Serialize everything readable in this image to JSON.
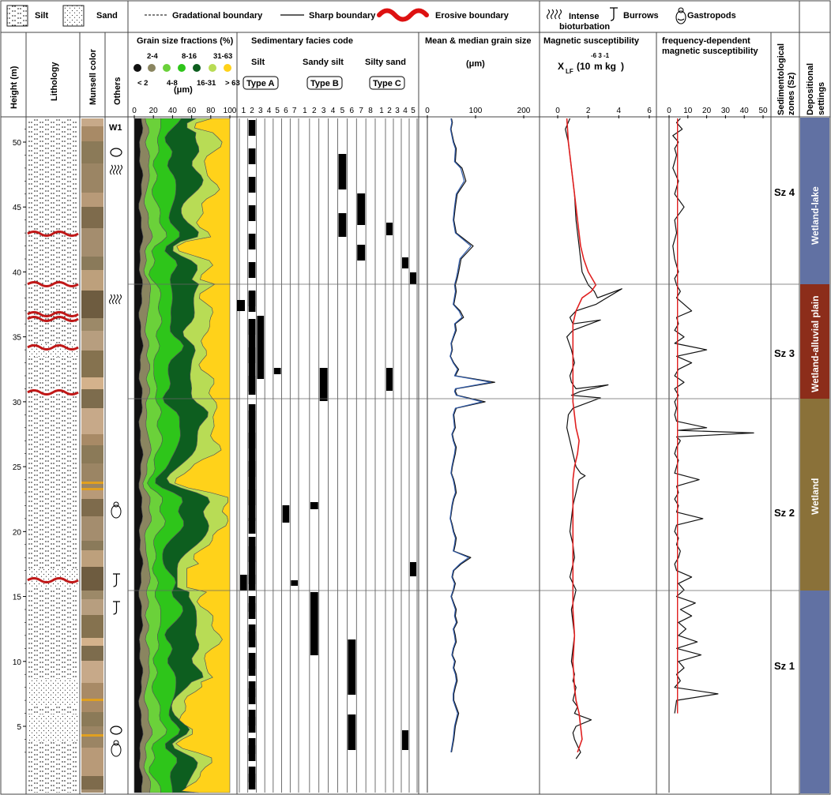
{
  "legend": {
    "silt": "Silt",
    "sand": "Sand",
    "gradational": "Gradational boundary",
    "sharp": "Sharp boundary",
    "erosive": "Erosive boundary",
    "bioturbation_line1": "Intense",
    "bioturbation_line2": "bioturbation",
    "burrows": "Burrows",
    "gastropods": "Gastropods"
  },
  "columns": {
    "height": "Height (m)",
    "lithology": "Lithology",
    "munsell": "Munsell color",
    "others": "Others",
    "grain_fractions": "Grain size fractions (%)",
    "facies": "Sedimentary facies code",
    "mean_median": "Mean & median grain size",
    "mag_sus": "Magnetic susceptibility",
    "fd_line1": "frequency-dependent",
    "fd_line2": "magnetic susceptibility",
    "sz_line1": "Sedimentological",
    "sz_line2": "zones (Sz)",
    "dep_line1": "Depositional",
    "dep_line2": "settings"
  },
  "grain_fraction_legend": {
    "classes": [
      {
        "label": "< 2",
        "color": "#111111"
      },
      {
        "label": "2-4",
        "color": "#8a8560"
      },
      {
        "label": "4-8",
        "color": "#6bd13a"
      },
      {
        "label": "8-16",
        "color": "#2ec51a"
      },
      {
        "label": "16-31",
        "color": "#0d5e1f"
      },
      {
        "label": "31-63",
        "color": "#b8dc55"
      },
      {
        "label": "> 63",
        "color": "#ffd21a"
      }
    ],
    "unit": "(μm)"
  },
  "facies_groups": [
    {
      "name": "Silt",
      "type": "Type A",
      "codes": [
        "1",
        "2",
        "3",
        "4",
        "5",
        "6",
        "7"
      ]
    },
    {
      "name": "Sandy silt",
      "type": "Type B",
      "codes": [
        "1",
        "2",
        "3",
        "4",
        "5",
        "6",
        "7",
        "8"
      ]
    },
    {
      "name": "Silty sand",
      "type": "Type C",
      "codes": [
        "1",
        "2",
        "3",
        "4",
        "5"
      ]
    }
  ],
  "others_label_w1": "W1",
  "mean_unit": "(μm)",
  "ms_unit": {
    "x": "X",
    "sub": "LF",
    "paren": "(10",
    "exp": "-6  3  -1",
    "m": "m kg",
    "close": ")"
  },
  "zones": [
    "Sz 4",
    "Sz 3",
    "Sz 2",
    "Sz 1"
  ],
  "settings": [
    {
      "label": "Wetland-lake",
      "color": "#6171a3"
    },
    {
      "label": "Wetland-alluvial plain",
      "color": "#8c2d1a"
    },
    {
      "label": "Wetland",
      "color": "#8a7139"
    },
    {
      "label": "",
      "color": "#6171a3"
    }
  ],
  "axes": {
    "height_ticks": [
      "5",
      "10",
      "15",
      "20",
      "25",
      "30",
      "35",
      "40",
      "45",
      "50"
    ],
    "grain_ticks": [
      "0",
      "20",
      "40",
      "60",
      "80",
      "100"
    ],
    "mean_ticks": [
      "0",
      "100",
      "200"
    ],
    "ms_ticks": [
      "0",
      "2",
      "4",
      "6"
    ],
    "fd_ticks": [
      "0",
      "10",
      "20",
      "30",
      "40",
      "50"
    ]
  },
  "chart_data": [
    {
      "type": "line",
      "name": "mean_grain_size",
      "ylim": [
        0,
        52
      ],
      "xlim": [
        0,
        200
      ],
      "x": [
        50,
        52,
        49,
        55,
        60,
        58,
        72,
        80,
        62,
        58,
        55,
        60,
        95,
        70,
        65,
        62,
        58,
        60,
        55,
        68,
        75,
        58,
        60,
        55,
        50,
        52,
        48,
        55,
        65,
        58,
        140,
        60,
        58,
        62,
        120,
        60,
        55,
        58,
        52,
        55,
        60,
        58,
        55,
        52,
        50,
        55,
        58,
        60,
        55,
        52,
        50,
        48,
        52,
        55,
        60,
        58,
        55,
        90,
        70,
        55,
        52,
        58,
        55,
        50,
        55,
        60,
        58,
        62,
        55,
        58,
        60,
        55,
        52,
        58,
        55,
        60,
        62,
        58,
        55,
        55,
        60,
        65,
        58,
        55,
        50
      ],
      "depth": [
        52,
        51.5,
        51,
        50,
        49.5,
        48.5,
        48,
        47,
        46,
        45,
        44,
        43,
        42,
        41,
        40,
        39.5,
        39,
        38.5,
        37.5,
        37,
        36.5,
        36,
        35.5,
        35,
        34.5,
        34,
        33.5,
        33,
        32.5,
        32,
        31.5,
        31,
        30.8,
        30.5,
        30,
        29.5,
        29,
        28,
        27.5,
        27,
        26.5,
        26,
        25.5,
        25,
        24.5,
        24,
        23.5,
        23,
        22.5,
        22,
        21.5,
        21,
        20.5,
        20,
        19.5,
        19,
        18.5,
        18,
        17.5,
        17,
        16.5,
        16,
        15.5,
        15,
        14.5,
        14,
        13.5,
        13,
        12.5,
        12,
        11.5,
        11,
        10.5,
        10,
        9.5,
        9,
        8.5,
        8,
        7.5,
        7,
        6.5,
        6,
        5,
        4,
        3
      ]
    },
    {
      "type": "line",
      "name": "magnetic_susceptibility_xLF",
      "ylim": [
        0,
        52
      ],
      "xlim": [
        0,
        6
      ],
      "x": [
        0.8,
        0.5,
        0.7,
        0.9,
        1.1,
        1.2,
        1.4,
        1.5,
        1.6,
        1.8,
        2.0,
        2.4,
        2.6,
        4.2,
        2.5,
        1.2,
        0.8,
        1.0,
        2.8,
        1.0,
        0.6,
        0.9,
        1.1,
        0.8,
        0.9,
        1.2,
        3.3,
        1.5,
        0.9,
        2.8,
        1.0,
        0.7,
        0.6,
        0.8,
        0.9,
        1.0,
        1.1,
        1.2,
        1.5,
        1.8,
        1.4,
        1.2,
        1.0,
        0.9,
        0.8,
        1.0,
        1.1,
        0.9,
        0.8,
        1.0,
        1.2,
        1.1,
        0.9,
        1.0,
        1.1,
        1.0,
        0.9,
        1.0,
        1.1,
        1.0,
        1.2,
        1.1,
        1.0,
        1.3,
        1.1,
        1.5,
        2.2,
        1.2,
        1.0,
        1.1,
        1.3,
        1.5,
        1.2
      ],
      "depth": [
        52,
        51,
        50,
        48,
        46,
        44,
        42,
        41,
        40,
        39.5,
        39,
        38.5,
        38,
        38.7,
        37.5,
        37,
        36.5,
        36,
        36.3,
        35.5,
        35,
        34,
        33,
        32,
        31.5,
        31,
        31.3,
        30.8,
        30.5,
        30.3,
        29.5,
        29,
        28,
        27,
        26.5,
        26,
        25.5,
        25,
        24.5,
        24.3,
        24,
        23,
        22,
        21,
        20,
        19,
        18,
        17,
        16.5,
        16,
        15.5,
        15,
        14,
        13,
        12,
        11,
        10,
        9.5,
        9,
        8.5,
        8,
        7.5,
        7,
        6.5,
        6,
        5.8,
        5.5,
        5,
        4.5,
        4,
        3.5,
        3,
        2.5
      ]
    },
    {
      "type": "line",
      "name": "magnetic_susceptibility_smoothed",
      "ylim": [
        0,
        52
      ],
      "xlim": [
        0,
        6
      ],
      "x": [
        0.6,
        0.7,
        0.9,
        1.1,
        1.3,
        1.5,
        1.7,
        2.0,
        2.5,
        2.2,
        1.6,
        1.2,
        1.0,
        1.0,
        1.0,
        1.0,
        1.0,
        1.0,
        1.0,
        1.2,
        1.4,
        1.3,
        1.1,
        1.0,
        1.0,
        1.0,
        1.0,
        1.0,
        1.0,
        1.0,
        1.0,
        1.1,
        1.0,
        1.1,
        1.2,
        1.4,
        1.5,
        1.6,
        1.3
      ],
      "depth": [
        52,
        50,
        48,
        46,
        44,
        42,
        41,
        40,
        39,
        38.5,
        38,
        37,
        36,
        35,
        34,
        33,
        32,
        31,
        30,
        28,
        27,
        26,
        25,
        24,
        23,
        22,
        21,
        20,
        18,
        16,
        14,
        12,
        10,
        8,
        7,
        6,
        5,
        4,
        3
      ]
    },
    {
      "type": "line",
      "name": "frequency_dependent_susceptibility",
      "ylim": [
        0,
        52
      ],
      "xlim": [
        0,
        50
      ],
      "x": [
        6,
        4,
        7,
        2,
        5,
        3,
        4,
        2,
        5,
        3,
        8,
        3,
        4,
        2,
        3,
        5,
        3,
        4,
        6,
        4,
        12,
        4,
        5,
        3,
        8,
        3,
        20,
        4,
        12,
        5,
        3,
        8,
        3,
        5,
        3,
        4,
        3,
        4,
        20,
        5,
        45,
        4,
        6,
        4,
        3,
        5,
        4,
        3,
        16,
        4,
        5,
        3,
        5,
        4,
        18,
        4,
        3,
        5,
        4,
        6,
        5,
        3,
        4,
        12,
        5,
        8,
        4,
        14,
        6,
        12,
        5,
        9,
        5,
        15,
        4,
        17,
        5,
        8,
        4,
        6,
        3,
        26,
        4,
        3
      ],
      "depth": [
        52,
        51.5,
        51,
        50.5,
        50,
        49.5,
        49,
        48,
        47,
        46,
        45,
        44,
        43,
        42,
        41,
        40,
        39.5,
        39,
        38.5,
        38,
        37,
        36.5,
        36,
        35.5,
        35,
        34.5,
        34,
        33.5,
        33,
        32.5,
        32,
        31.5,
        31,
        30.5,
        30,
        29.5,
        29,
        28.5,
        28,
        27.8,
        27.6,
        27.3,
        27,
        26.5,
        26,
        25.5,
        25,
        24.5,
        24,
        23.5,
        23,
        22.5,
        22,
        21.5,
        21,
        20.5,
        20,
        19.5,
        19,
        18.5,
        18,
        17.5,
        17,
        16.5,
        16,
        15.5,
        15,
        14.5,
        14,
        13.5,
        13,
        12.5,
        12,
        11.5,
        11,
        10.5,
        10,
        9.5,
        9,
        8.5,
        8,
        7.5,
        7,
        6
      ]
    }
  ]
}
